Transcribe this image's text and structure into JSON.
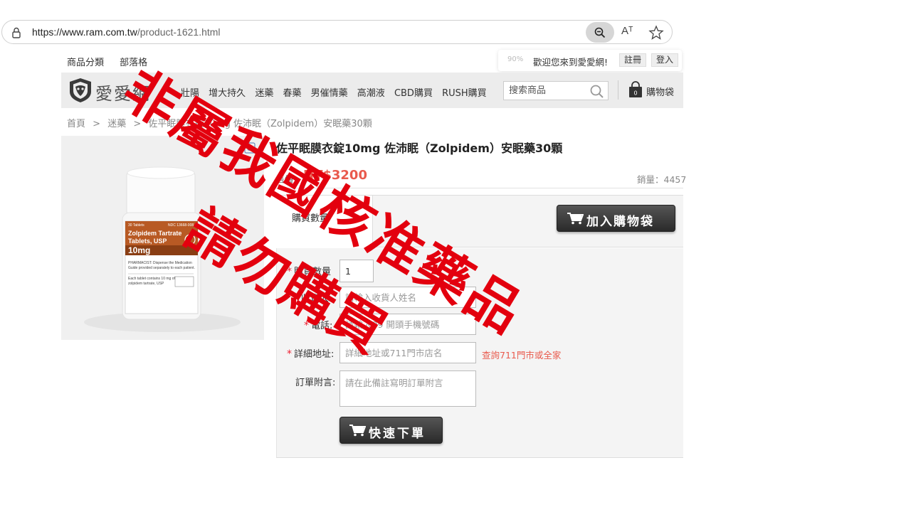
{
  "browser": {
    "url_host": "https://www.ram.com.tw",
    "url_path": "/product-1621.html",
    "read_aloud_label": "Aᵀ"
  },
  "topnav": {
    "items": [
      "商品分類",
      "部落格"
    ]
  },
  "account_bar": {
    "zoom_hint": "90%",
    "welcome": "歡迎您來到愛愛網!",
    "register": "註冊",
    "login": "登入"
  },
  "site": {
    "logo_text": "愛愛網",
    "nav_items": [
      "壯陽",
      "增大持久",
      "迷藥",
      "春藥",
      "男催情藥",
      "高潮液",
      "CBD購買",
      "RUSH購買"
    ],
    "search_placeholder": "搜索商品",
    "cart_count": "0",
    "cart_label": "購物袋"
  },
  "breadcrumb": [
    "首頁",
    ">",
    "迷藥",
    ">",
    "佐平眠膜衣錠10mg 佐沛眠（Zolpidem）安眠藥30顆"
  ],
  "product": {
    "title": "佐平眠膜衣錠10mg 佐沛眠（Zolpidem）安眠藥30顆",
    "price_label": "售價",
    "price": "NT$3200",
    "sold": "銷量：4457",
    "image_label": {
      "count": "30 Tablets",
      "ndc": "NDC 13668-008",
      "name": "Zolpidem Tartrate",
      "form": "Tablets, USP",
      "dose": "10mg",
      "note1": "PHARMACIST: Dispense the Medication",
      "note2": "Guide provided separately to each patient.",
      "note3": "Each tablet contains 10 mg of",
      "note4": "zolpidem tartrate, USP"
    }
  },
  "purchase": {
    "qty_tab": "購買數量",
    "add_to_cart": "加入購物袋"
  },
  "form": {
    "qty_label": "購買數量",
    "qty_value": "1",
    "name_label": "收貨人",
    "name_placeholder": "請輸入收貨人姓名",
    "phone_label": "電話",
    "phone_placeholder": "請輸入09 開頭手機號碼",
    "address_label": "詳細地址:",
    "address_placeholder": "詳細地址或711門市店名",
    "store_link": "查詢711門市或全家",
    "note_label": "訂單附言:",
    "note_placeholder": "請在此備註寫明訂單附言",
    "submit": "快速下單"
  },
  "watermark": {
    "line1": "非屬我國核准藥品",
    "line2": "請勿購買",
    "color": "#e3000e"
  }
}
